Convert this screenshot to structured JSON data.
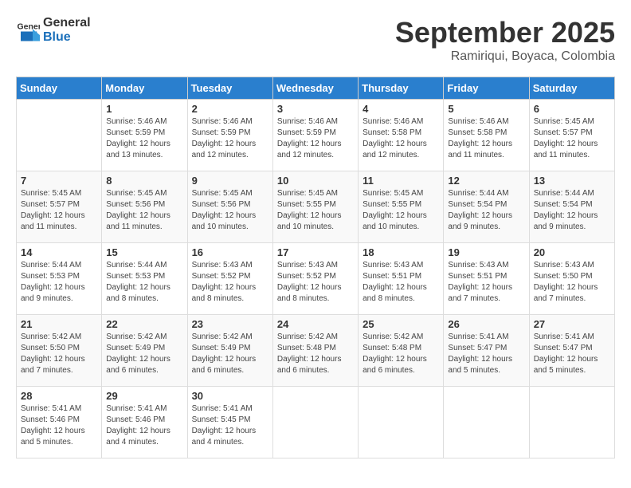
{
  "header": {
    "logo_line1": "General",
    "logo_line2": "Blue",
    "month": "September 2025",
    "location": "Ramiriqui, Boyaca, Colombia"
  },
  "days_of_week": [
    "Sunday",
    "Monday",
    "Tuesday",
    "Wednesday",
    "Thursday",
    "Friday",
    "Saturday"
  ],
  "weeks": [
    [
      {
        "num": "",
        "detail": ""
      },
      {
        "num": "1",
        "detail": "Sunrise: 5:46 AM\nSunset: 5:59 PM\nDaylight: 12 hours\nand 13 minutes."
      },
      {
        "num": "2",
        "detail": "Sunrise: 5:46 AM\nSunset: 5:59 PM\nDaylight: 12 hours\nand 12 minutes."
      },
      {
        "num": "3",
        "detail": "Sunrise: 5:46 AM\nSunset: 5:59 PM\nDaylight: 12 hours\nand 12 minutes."
      },
      {
        "num": "4",
        "detail": "Sunrise: 5:46 AM\nSunset: 5:58 PM\nDaylight: 12 hours\nand 12 minutes."
      },
      {
        "num": "5",
        "detail": "Sunrise: 5:46 AM\nSunset: 5:58 PM\nDaylight: 12 hours\nand 11 minutes."
      },
      {
        "num": "6",
        "detail": "Sunrise: 5:45 AM\nSunset: 5:57 PM\nDaylight: 12 hours\nand 11 minutes."
      }
    ],
    [
      {
        "num": "7",
        "detail": "Sunrise: 5:45 AM\nSunset: 5:57 PM\nDaylight: 12 hours\nand 11 minutes."
      },
      {
        "num": "8",
        "detail": "Sunrise: 5:45 AM\nSunset: 5:56 PM\nDaylight: 12 hours\nand 11 minutes."
      },
      {
        "num": "9",
        "detail": "Sunrise: 5:45 AM\nSunset: 5:56 PM\nDaylight: 12 hours\nand 10 minutes."
      },
      {
        "num": "10",
        "detail": "Sunrise: 5:45 AM\nSunset: 5:55 PM\nDaylight: 12 hours\nand 10 minutes."
      },
      {
        "num": "11",
        "detail": "Sunrise: 5:45 AM\nSunset: 5:55 PM\nDaylight: 12 hours\nand 10 minutes."
      },
      {
        "num": "12",
        "detail": "Sunrise: 5:44 AM\nSunset: 5:54 PM\nDaylight: 12 hours\nand 9 minutes."
      },
      {
        "num": "13",
        "detail": "Sunrise: 5:44 AM\nSunset: 5:54 PM\nDaylight: 12 hours\nand 9 minutes."
      }
    ],
    [
      {
        "num": "14",
        "detail": "Sunrise: 5:44 AM\nSunset: 5:53 PM\nDaylight: 12 hours\nand 9 minutes."
      },
      {
        "num": "15",
        "detail": "Sunrise: 5:44 AM\nSunset: 5:53 PM\nDaylight: 12 hours\nand 8 minutes."
      },
      {
        "num": "16",
        "detail": "Sunrise: 5:43 AM\nSunset: 5:52 PM\nDaylight: 12 hours\nand 8 minutes."
      },
      {
        "num": "17",
        "detail": "Sunrise: 5:43 AM\nSunset: 5:52 PM\nDaylight: 12 hours\nand 8 minutes."
      },
      {
        "num": "18",
        "detail": "Sunrise: 5:43 AM\nSunset: 5:51 PM\nDaylight: 12 hours\nand 8 minutes."
      },
      {
        "num": "19",
        "detail": "Sunrise: 5:43 AM\nSunset: 5:51 PM\nDaylight: 12 hours\nand 7 minutes."
      },
      {
        "num": "20",
        "detail": "Sunrise: 5:43 AM\nSunset: 5:50 PM\nDaylight: 12 hours\nand 7 minutes."
      }
    ],
    [
      {
        "num": "21",
        "detail": "Sunrise: 5:42 AM\nSunset: 5:50 PM\nDaylight: 12 hours\nand 7 minutes."
      },
      {
        "num": "22",
        "detail": "Sunrise: 5:42 AM\nSunset: 5:49 PM\nDaylight: 12 hours\nand 6 minutes."
      },
      {
        "num": "23",
        "detail": "Sunrise: 5:42 AM\nSunset: 5:49 PM\nDaylight: 12 hours\nand 6 minutes."
      },
      {
        "num": "24",
        "detail": "Sunrise: 5:42 AM\nSunset: 5:48 PM\nDaylight: 12 hours\nand 6 minutes."
      },
      {
        "num": "25",
        "detail": "Sunrise: 5:42 AM\nSunset: 5:48 PM\nDaylight: 12 hours\nand 6 minutes."
      },
      {
        "num": "26",
        "detail": "Sunrise: 5:41 AM\nSunset: 5:47 PM\nDaylight: 12 hours\nand 5 minutes."
      },
      {
        "num": "27",
        "detail": "Sunrise: 5:41 AM\nSunset: 5:47 PM\nDaylight: 12 hours\nand 5 minutes."
      }
    ],
    [
      {
        "num": "28",
        "detail": "Sunrise: 5:41 AM\nSunset: 5:46 PM\nDaylight: 12 hours\nand 5 minutes."
      },
      {
        "num": "29",
        "detail": "Sunrise: 5:41 AM\nSunset: 5:46 PM\nDaylight: 12 hours\nand 4 minutes."
      },
      {
        "num": "30",
        "detail": "Sunrise: 5:41 AM\nSunset: 5:45 PM\nDaylight: 12 hours\nand 4 minutes."
      },
      {
        "num": "",
        "detail": ""
      },
      {
        "num": "",
        "detail": ""
      },
      {
        "num": "",
        "detail": ""
      },
      {
        "num": "",
        "detail": ""
      }
    ]
  ]
}
